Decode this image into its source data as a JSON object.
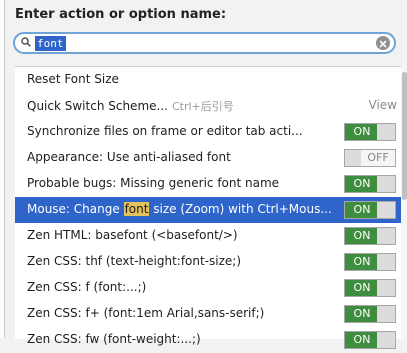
{
  "prompt": {
    "title": "Enter action or option name:"
  },
  "search": {
    "value": "font"
  },
  "list": {
    "rows": [
      {
        "label": "Reset Font Size"
      },
      {
        "label": "Quick Switch Scheme...",
        "shortcut": "Ctrl+后引号",
        "extra": "View"
      },
      {
        "label": "Synchronize files on frame or editor tab acti...",
        "toggle": "ON"
      },
      {
        "label": "Appearance: Use anti-aliased font",
        "toggle": "OFF"
      },
      {
        "label": "Probable bugs: Missing generic font name",
        "toggle": "ON"
      },
      {
        "label_pre": "Mouse: Change ",
        "label_hl": "font",
        "label_post": " size (Zoom) with Ctrl+Mous...",
        "toggle": "ON",
        "selected": true
      },
      {
        "label": "Zen HTML: basefont (<basefont/>)",
        "toggle": "ON"
      },
      {
        "label": "Zen CSS: thf (text-height:font-size;)",
        "toggle": "ON"
      },
      {
        "label": "Zen CSS: f (font:...;)",
        "toggle": "ON"
      },
      {
        "label": "Zen CSS: f+ (font:1em Arial,sans-serif;)",
        "toggle": "ON"
      },
      {
        "label": "Zen CSS: fw (font-weight:...;)",
        "toggle": "ON"
      }
    ]
  },
  "colors": {
    "accent": "#2f65ca",
    "on": "#3f8d3f",
    "highlight": "#e3c15b"
  }
}
